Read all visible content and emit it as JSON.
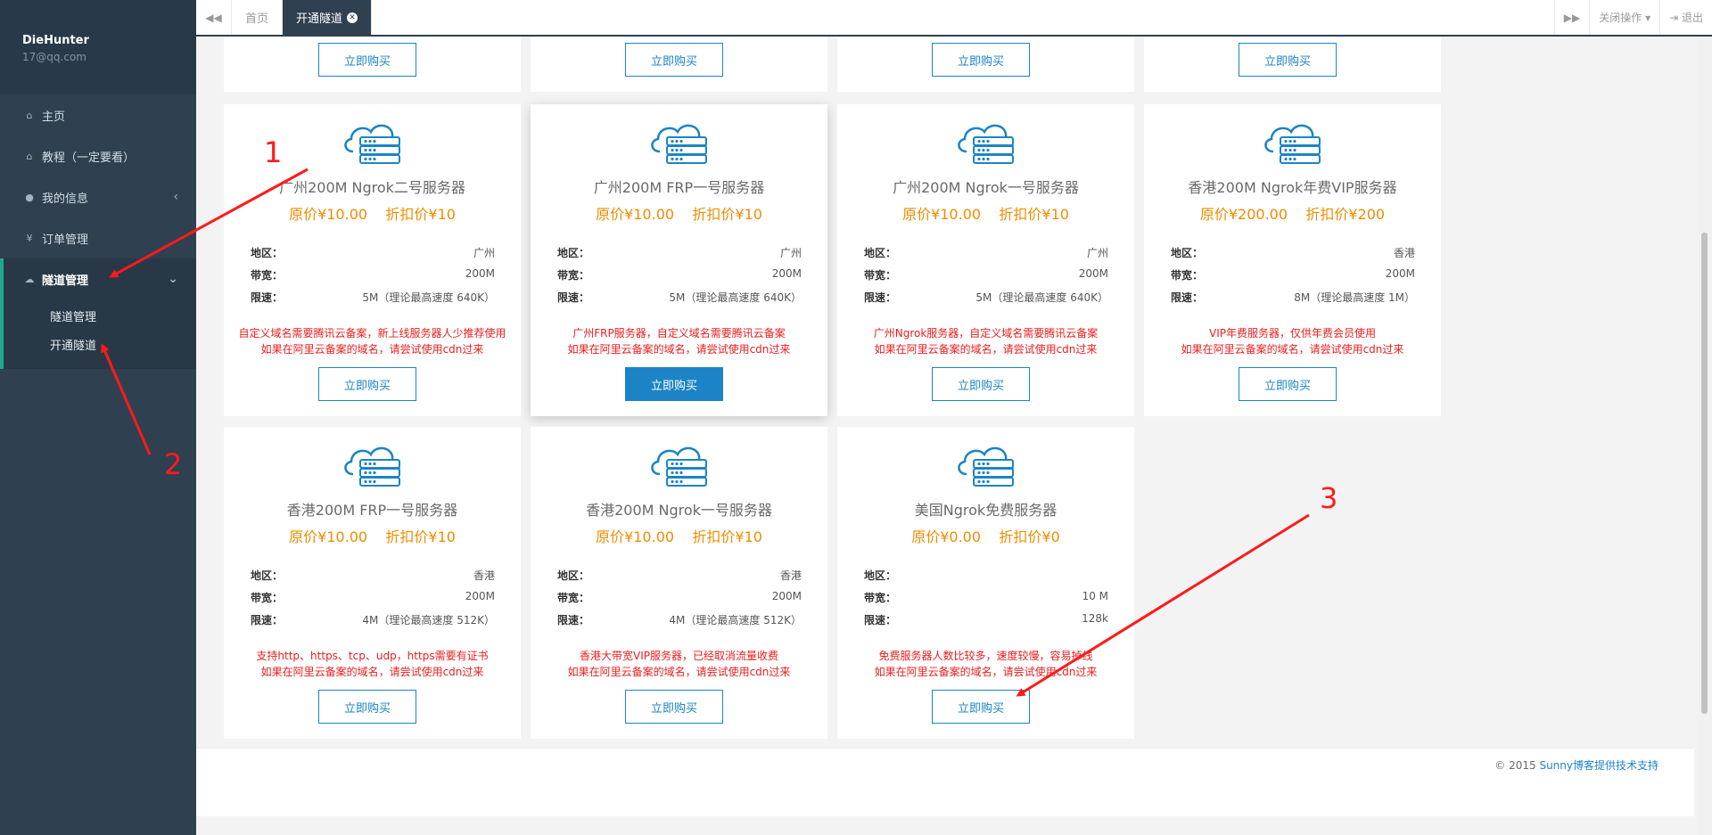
{
  "sidebar": {
    "username": "DieHunter",
    "email": "17@qq.com",
    "items": [
      {
        "label": "主页",
        "icon": "home-icon"
      },
      {
        "label": "教程（一定要看）",
        "icon": "home-icon"
      },
      {
        "label": "我的信息",
        "icon": "user-icon"
      },
      {
        "label": "订单管理",
        "icon": "yen-icon"
      }
    ],
    "group": {
      "label": "隧道管理",
      "icon": "cloud-icon",
      "subitems": [
        {
          "label": "隧道管理"
        },
        {
          "label": "开通隧道"
        }
      ]
    }
  },
  "topbar": {
    "tabs": [
      {
        "label": "首页"
      },
      {
        "label": "开通隧道"
      }
    ],
    "close_ops": "关闭操作",
    "logout": "退出"
  },
  "buy_label": "立即购买",
  "spec_keys": {
    "region": "地区：",
    "bandwidth": "带宽：",
    "limit": "限速："
  },
  "cards": [
    {
      "title": "广州200M Ngrok二号服务器",
      "price": "原价¥10.00    折扣价¥10",
      "region": "广州",
      "bandwidth": "200M",
      "limit": "5M（理论最高速度 640K）",
      "note1": "自定义域名需要腾讯云备案，新上线服务器人少推荐使用",
      "note2": "如果在阿里云备案的域名，请尝试使用cdn过来"
    },
    {
      "title": "广州200M FRP一号服务器",
      "price": "原价¥10.00    折扣价¥10",
      "region": "广州",
      "bandwidth": "200M",
      "limit": "5M（理论最高速度 640K）",
      "note1": "广州FRP服务器，自定义域名需要腾讯云备案",
      "note2": "如果在阿里云备案的域名，请尝试使用cdn过来"
    },
    {
      "title": "广州200M Ngrok一号服务器",
      "price": "原价¥10.00    折扣价¥10",
      "region": "广州",
      "bandwidth": "200M",
      "limit": "5M（理论最高速度 640K）",
      "note1": "广州Ngrok服务器，自定义域名需要腾讯云备案",
      "note2": "如果在阿里云备案的域名，请尝试使用cdn过来"
    },
    {
      "title": "香港200M Ngrok年费VIP服务器",
      "price": "原价¥200.00    折扣价¥200",
      "region": "香港",
      "bandwidth": "200M",
      "limit": "8M（理论最高速度 1M）",
      "note1": "VIP年费服务器，仅供年费会员使用",
      "note2": "如果在阿里云备案的域名，请尝试使用cdn过来"
    },
    {
      "title": "香港200M FRP一号服务器",
      "price": "原价¥10.00    折扣价¥10",
      "region": "香港",
      "bandwidth": "200M",
      "limit": "4M（理论最高速度 512K）",
      "note1": "支持http、https、tcp、udp，https需要有证书",
      "note2": "如果在阿里云备案的域名，请尝试使用cdn过来"
    },
    {
      "title": "香港200M Ngrok一号服务器",
      "price": "原价¥10.00    折扣价¥10",
      "region": "香港",
      "bandwidth": "200M",
      "limit": "4M（理论最高速度 512K）",
      "note1": "香港大带宽VIP服务器，已经取消流量收费",
      "note2": "如果在阿里云备案的域名，请尝试使用cdn过来"
    },
    {
      "title": "美国Ngrok免费服务器",
      "price": "原价¥0.00    折扣价¥0",
      "region": "",
      "bandwidth": "10 M",
      "limit": "128k",
      "note1": "免费服务器人数比较多，速度较慢，容易掉线",
      "note2": "如果在阿里云备案的域名，请尝试使用cdn过来"
    }
  ],
  "footer": {
    "prefix": "© 2015 ",
    "link": "Sunny博客提供技术支持"
  },
  "annotations": [
    "1",
    "2",
    "3"
  ],
  "colors": {
    "sidebar": "#2f4050",
    "accent": "#1c84c6",
    "price": "#f08c00",
    "note": "#ed1c1c",
    "annotation": "#ff1a1a"
  }
}
